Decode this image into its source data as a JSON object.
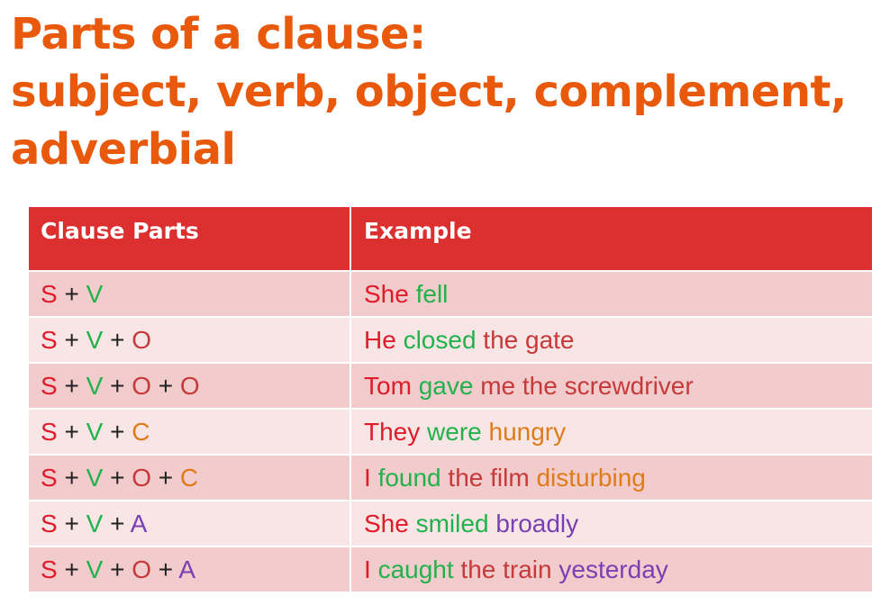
{
  "title": {
    "line1": "Parts of a clause:",
    "line2": "subject, verb, object, complement,",
    "line3": "adverbial"
  },
  "colors": {
    "title": "#e8590c",
    "header_bg": "#dc2f2f",
    "row_odd": "#f2cbcc",
    "row_even": "#f8e6e6",
    "subject": "#e01b2a",
    "verb": "#22b24c",
    "object": "#c63a3a",
    "complement": "#e07b1a",
    "adverbial": "#7a3fb3"
  },
  "table": {
    "headers": [
      "Clause Parts",
      "Example"
    ],
    "rows": [
      {
        "parts": [
          {
            "text": "S",
            "role": "s"
          },
          {
            "text": " + ",
            "role": "plus"
          },
          {
            "text": "V",
            "role": "v"
          }
        ],
        "example": [
          {
            "text": "She ",
            "role": "s"
          },
          {
            "text": "fell",
            "role": "v"
          }
        ]
      },
      {
        "parts": [
          {
            "text": "S",
            "role": "s"
          },
          {
            "text": " + ",
            "role": "plus"
          },
          {
            "text": "V",
            "role": "v"
          },
          {
            "text": " + ",
            "role": "plus"
          },
          {
            "text": "O",
            "role": "o"
          }
        ],
        "example": [
          {
            "text": "He ",
            "role": "s"
          },
          {
            "text": "closed ",
            "role": "v"
          },
          {
            "text": "the gate",
            "role": "o"
          }
        ]
      },
      {
        "parts": [
          {
            "text": "S",
            "role": "s"
          },
          {
            "text": " + ",
            "role": "plus"
          },
          {
            "text": "V",
            "role": "v"
          },
          {
            "text": " + ",
            "role": "plus"
          },
          {
            "text": "O",
            "role": "o"
          },
          {
            "text": " + ",
            "role": "plus"
          },
          {
            "text": "O",
            "role": "o"
          }
        ],
        "example": [
          {
            "text": "Tom ",
            "role": "s"
          },
          {
            "text": "gave ",
            "role": "v"
          },
          {
            "text": "me the screwdriver",
            "role": "o"
          }
        ]
      },
      {
        "parts": [
          {
            "text": "S",
            "role": "s"
          },
          {
            "text": " + ",
            "role": "plus"
          },
          {
            "text": "V",
            "role": "v"
          },
          {
            "text": " + ",
            "role": "plus"
          },
          {
            "text": "C",
            "role": "c"
          }
        ],
        "example": [
          {
            "text": "They ",
            "role": "s"
          },
          {
            "text": "were ",
            "role": "v"
          },
          {
            "text": "hungry",
            "role": "c"
          }
        ]
      },
      {
        "parts": [
          {
            "text": "S",
            "role": "s"
          },
          {
            "text": " + ",
            "role": "plus"
          },
          {
            "text": "V",
            "role": "v"
          },
          {
            "text": " + ",
            "role": "plus"
          },
          {
            "text": "O",
            "role": "o"
          },
          {
            "text": " + ",
            "role": "plus"
          },
          {
            "text": "C",
            "role": "c"
          }
        ],
        "example": [
          {
            "text": "I ",
            "role": "s"
          },
          {
            "text": "found ",
            "role": "v"
          },
          {
            "text": "the film ",
            "role": "o"
          },
          {
            "text": "disturbing",
            "role": "c"
          }
        ]
      },
      {
        "parts": [
          {
            "text": "S",
            "role": "s"
          },
          {
            "text": " + ",
            "role": "plus"
          },
          {
            "text": "V",
            "role": "v"
          },
          {
            "text": " + ",
            "role": "plus"
          },
          {
            "text": "A",
            "role": "a"
          }
        ],
        "example": [
          {
            "text": "She ",
            "role": "s"
          },
          {
            "text": "smiled ",
            "role": "v"
          },
          {
            "text": "broadly",
            "role": "a"
          }
        ]
      },
      {
        "parts": [
          {
            "text": "S",
            "role": "s"
          },
          {
            "text": " + ",
            "role": "plus"
          },
          {
            "text": "V",
            "role": "v"
          },
          {
            "text": " + ",
            "role": "plus"
          },
          {
            "text": "O",
            "role": "o"
          },
          {
            "text": " + ",
            "role": "plus"
          },
          {
            "text": "A",
            "role": "a"
          }
        ],
        "example": [
          {
            "text": "I ",
            "role": "s"
          },
          {
            "text": "caught ",
            "role": "v"
          },
          {
            "text": "the train ",
            "role": "o"
          },
          {
            "text": "yesterday",
            "role": "a"
          }
        ]
      }
    ]
  }
}
